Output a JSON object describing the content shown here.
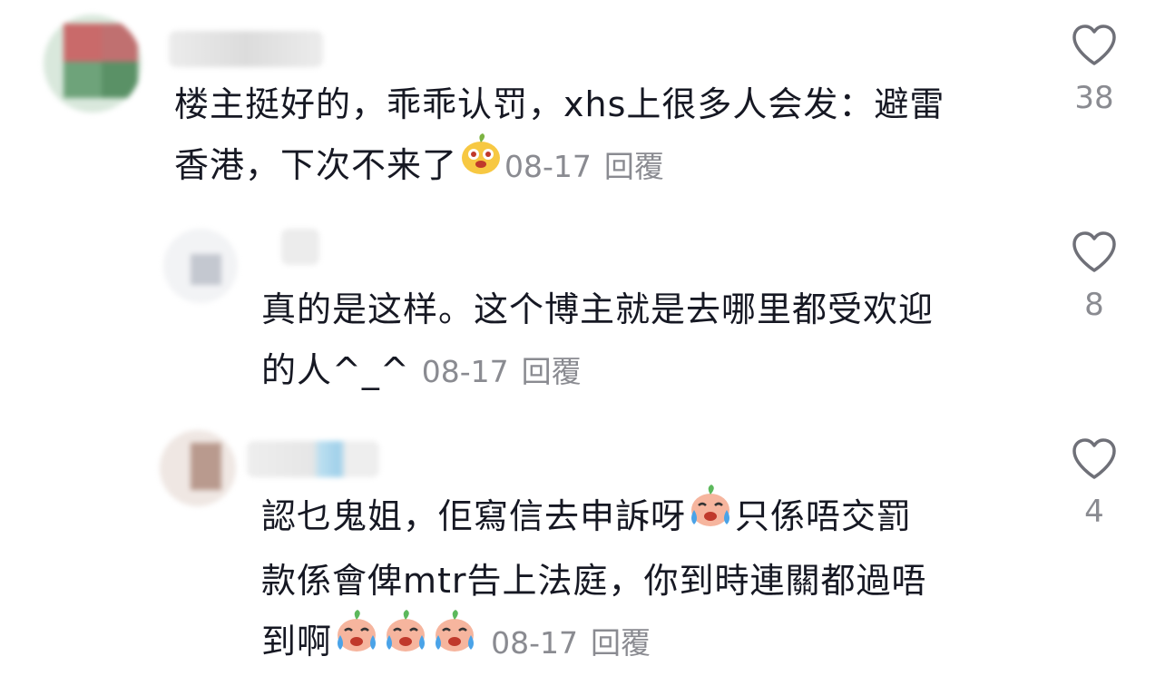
{
  "comments": [
    {
      "text_line1": "楼主挺好的，乖乖认罚，xhs上很多人会发：避雷",
      "text_line2": "香港，下次不来了",
      "date": "08-17",
      "reply": "回覆",
      "likes": "38",
      "emoji": "laughing-critter-emoji"
    },
    {
      "text_line1": "真的是这样。这个博主就是去哪里都受欢迎",
      "text_line2": "的人^_^",
      "date": "08-17",
      "reply": "回覆",
      "likes": "8"
    },
    {
      "text_line1": "認乜鬼姐，佢寫信去申訴呀",
      "text_line1b": "只係唔交罰",
      "text_line2": "款係會俾mtr告上法庭，你到時連關都過唔",
      "text_line3": "到啊",
      "date": "08-17",
      "reply": "回覆",
      "likes": "4",
      "emoji": "crying-face-emoji"
    }
  ],
  "colors": {
    "text": "#161823",
    "meta": "#8a8b91",
    "heart_stroke": "#6f7078"
  }
}
